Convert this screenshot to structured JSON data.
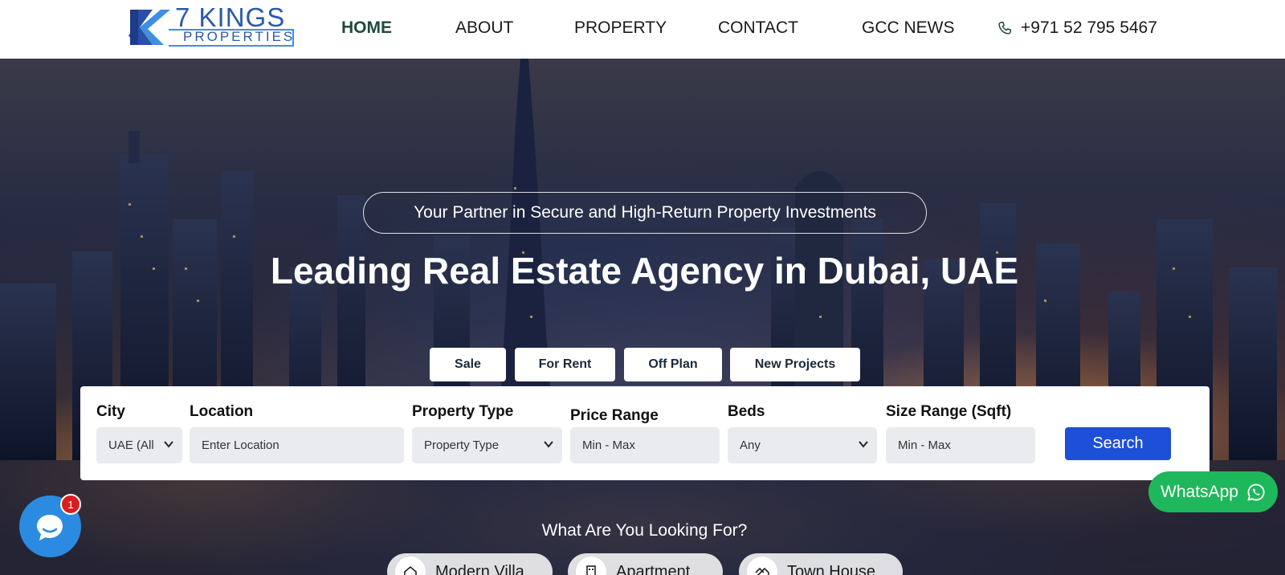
{
  "brand": {
    "top": "7 KINGS",
    "bottom": "PROPERTIES"
  },
  "nav": {
    "items": [
      {
        "label": "HOME",
        "active": true
      },
      {
        "label": "ABOUT",
        "active": false
      },
      {
        "label": "PROPERTY",
        "active": false
      },
      {
        "label": "CONTACT",
        "active": false
      },
      {
        "label": "GCC NEWS",
        "active": false
      }
    ],
    "phone": "+971 52 795 5467",
    "phone_icon": "phone-icon"
  },
  "hero": {
    "tagline": "Your Partner in Secure and High-Return Property Investments",
    "headline": "Leading Real Estate Agency in Dubai, UAE"
  },
  "tabs": [
    {
      "label": "Sale"
    },
    {
      "label": "For Rent"
    },
    {
      "label": "Off Plan"
    },
    {
      "label": "New Projects"
    }
  ],
  "search": {
    "city": {
      "label": "City",
      "value": "UAE (All"
    },
    "location": {
      "label": "Location",
      "placeholder": "Enter Location"
    },
    "property_type": {
      "label": "Property Type",
      "value": "Property Type"
    },
    "price_range": {
      "label": "Price Range",
      "placeholder": "Min - Max"
    },
    "beds": {
      "label": "Beds",
      "value": "Any"
    },
    "size_range": {
      "label": "Size Range (Sqft)",
      "placeholder": "Min - Max"
    },
    "button": "Search"
  },
  "whatsapp": {
    "label": "WhatsApp",
    "icon": "whatsapp-icon"
  },
  "chat": {
    "badge": "1",
    "icon": "chat-bubble-icon"
  },
  "looking": {
    "title": "What Are You Looking For?",
    "categories": [
      {
        "label": "Modern Villa",
        "icon": "villa-icon"
      },
      {
        "label": "Apartment",
        "icon": "apartment-icon"
      },
      {
        "label": "Town House",
        "icon": "townhouse-icon"
      }
    ]
  },
  "colors": {
    "accent": "#1e4fd8",
    "whatsapp": "#1fb75b",
    "chat": "#2a8be0",
    "brand": "#2a5aa8",
    "nav_active": "#1f4a3e"
  }
}
